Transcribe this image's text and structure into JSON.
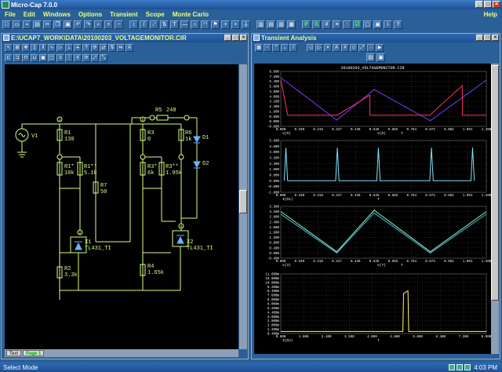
{
  "app": {
    "title": "Micro-Cap 7.0.0"
  },
  "menu": [
    "File",
    "Edit",
    "Windows",
    "Options",
    "Transient",
    "Scope",
    "Monte Carlo"
  ],
  "menu_help": "Help",
  "schematic": {
    "title": "E:\\UCAP7_WORK\\DATA\\20100203_VOLTAGEMONITOR.CIR",
    "page_tab": "Page 1",
    "text_tab": "Text",
    "components": {
      "V1": "V1",
      "R1": "R1",
      "R1v": "130",
      "R1a": "R1*",
      "R1av": "10k",
      "R1b": "R1**",
      "R1bv": "5.1k",
      "R7": "R7",
      "R7v": "50",
      "R5": "R5",
      "R5v": "248",
      "R3": "R3",
      "R3v": "0",
      "R3a": "R3*",
      "R3av": "6k",
      "R3b": "R3**",
      "R3bv": "1.95k",
      "R6": "R6",
      "R6v": "1k",
      "D1": "D1",
      "D2": "D2",
      "X1": "X1",
      "X1v": "TL431_TI",
      "X2": "X2",
      "X2v": "TL431_TI",
      "R2": "R2",
      "R2v": "3.3k",
      "R4": "R4",
      "R4v": "1.65k",
      "n1": "1",
      "n2": "2",
      "n3": "3",
      "n4": "4",
      "n5": "5",
      "n6": "6",
      "n7": "7",
      "n8": "8",
      "n9": "9",
      "n10": "10"
    }
  },
  "transient": {
    "title": "Transient Analysis",
    "file_label": "20100203_VOLTAGEMONITOR.CIR",
    "plots": [
      {
        "yticks": [
          "8.000",
          "7.200",
          "6.400",
          "5.600",
          "4.800",
          "4.000",
          "3.200",
          "2.400",
          "1.600",
          "0.800",
          "0.000",
          "-0.800"
        ],
        "xticks": [
          "0.000",
          "0.109",
          "0.218",
          "0.327",
          "0.436",
          "0.545",
          "0.655",
          "0.764",
          "0.873",
          "0.982",
          "1.091",
          "1.200"
        ],
        "xlabel": "v(6)",
        "legend": [
          "v(8)",
          "T"
        ]
      },
      {
        "yticks": [
          "5.600",
          "4.800",
          "4.000",
          "3.200",
          "2.400",
          "1.600",
          "0.800",
          "0.000",
          "-0.800",
          "-1.600"
        ],
        "xticks": [
          "0.000",
          "0.109",
          "0.218",
          "0.327",
          "0.436",
          "0.545",
          "0.655",
          "0.764",
          "0.873",
          "0.982",
          "1.091",
          "1.200"
        ],
        "xlabel": "I(D1)",
        "legend": [
          "T"
        ]
      },
      {
        "yticks": [
          "3.600",
          "3.200",
          "2.800",
          "2.400",
          "2.000",
          "1.600",
          "1.200",
          "0.800",
          "0.400",
          "0.000",
          "-0.400"
        ],
        "xticks": [
          "0.000",
          "0.109",
          "0.218",
          "0.327",
          "0.436",
          "0.545",
          "0.655",
          "0.764",
          "0.873",
          "0.982",
          "1.091",
          "1.200"
        ],
        "xlabel": "v(3)",
        "legend": [
          "v(7)",
          "T"
        ]
      },
      {
        "yticks": [
          "11.600m",
          "10.800m",
          "10.000m",
          "9.200m",
          "8.400m",
          "7.600m",
          "6.800m",
          "6.000m",
          "5.200m",
          "4.400m",
          "3.600m",
          "2.800m",
          "2.000m",
          "1.200m",
          "0.400m"
        ],
        "xticks": [
          "0.800",
          "1.600",
          "2.400",
          "3.200",
          "4.000",
          "4.800",
          "5.600",
          "6.400",
          "7.200",
          "8.000"
        ],
        "xlabel": "I(D2)",
        "legend": [
          "T"
        ]
      }
    ]
  },
  "chart_data": [
    {
      "type": "line",
      "xlim": [
        0,
        1.2
      ],
      "ylim": [
        -0.8,
        8
      ],
      "series": [
        {
          "name": "v(6)",
          "color": "#7a3cff",
          "x": [
            0,
            0.327,
            0.545,
            0.873,
            1.2
          ],
          "y": [
            7.0,
            0.2,
            5.1,
            0.1,
            6.6
          ]
        },
        {
          "name": "v(8)",
          "color": "#ff3060",
          "x": [
            0,
            0.04,
            0.04,
            0.33,
            0.33,
            0.52,
            0.52,
            0.58,
            0.58,
            0.87,
            0.87,
            1.06,
            1.06,
            1.2
          ],
          "y": [
            6.7,
            1.0,
            1.0,
            1.0,
            1.0,
            4.2,
            1.0,
            1.0,
            1.0,
            1.0,
            1.0,
            5.7,
            1.0,
            1.0
          ]
        }
      ]
    },
    {
      "type": "line",
      "xlim": [
        0,
        1.2
      ],
      "ylim": [
        -1.6,
        5.6
      ],
      "series": [
        {
          "name": "I(D1)",
          "color": "#80e0ff",
          "x": [
            0.02,
            0.03,
            0.04,
            0.32,
            0.33,
            0.34,
            0.56,
            0.57,
            0.58,
            0.87,
            0.88,
            0.89,
            1.11,
            1.12,
            1.13
          ],
          "y": [
            0,
            4.6,
            0,
            0,
            4.6,
            0,
            0,
            4.6,
            0,
            0,
            4.6,
            0,
            0,
            4.6,
            0
          ]
        }
      ]
    },
    {
      "type": "line",
      "xlim": [
        0,
        1.2
      ],
      "ylim": [
        -0.4,
        3.6
      ],
      "series": [
        {
          "name": "v(3)",
          "color": "#90ffb0",
          "x": [
            0,
            0.327,
            0.545,
            0.873,
            1.2
          ],
          "y": [
            3.2,
            0.1,
            3.3,
            0.1,
            3.2
          ]
        },
        {
          "name": "v(7)",
          "color": "#40c0ff",
          "x": [
            0,
            0.327,
            0.545,
            0.873,
            1.2
          ],
          "y": [
            3.0,
            0.0,
            3.1,
            0.0,
            3.0
          ]
        }
      ]
    },
    {
      "type": "line",
      "xlim": [
        0,
        8.0
      ],
      "ylim": [
        0,
        11.6
      ],
      "series": [
        {
          "name": "I(D2)",
          "color": "#ffff60",
          "x": [
            0,
            4.75,
            4.78,
            4.95,
            4.98,
            8.0
          ],
          "y": [
            0.4,
            0.4,
            7.8,
            8.3,
            0.4,
            0.4
          ]
        }
      ]
    }
  ],
  "status": {
    "left": "Select Mode",
    "clock": "4:03 PM"
  }
}
